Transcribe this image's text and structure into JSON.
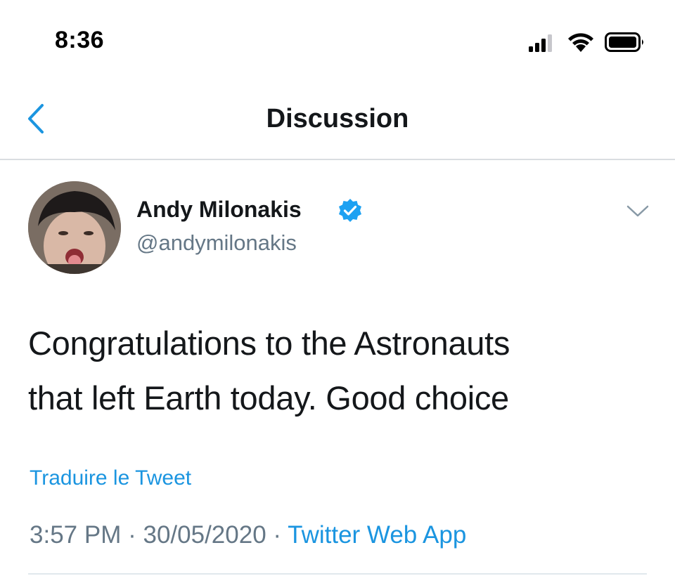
{
  "status_bar": {
    "time": "8:36",
    "icons": [
      "cellular-signal-icon",
      "wifi-icon",
      "battery-icon"
    ]
  },
  "nav": {
    "back_icon": "chevron-left-icon",
    "title": "Discussion"
  },
  "tweet": {
    "author_name": "Andy Milonakis",
    "verified": true,
    "handle": "@andymilonakis",
    "menu_icon": "chevron-down-icon",
    "text_line1": "Congratulations to the Astronauts",
    "text_line2": "that left Earth today. Good choice",
    "translate_label": "Traduire le Tweet",
    "time": "3:57 PM",
    "separator": "·",
    "date": "30/05/2020",
    "source": "Twitter Web App"
  },
  "colors": {
    "accent": "#1b95e0",
    "text_primary": "#14171a",
    "text_secondary": "#657786",
    "divider": "#d9dde1"
  }
}
